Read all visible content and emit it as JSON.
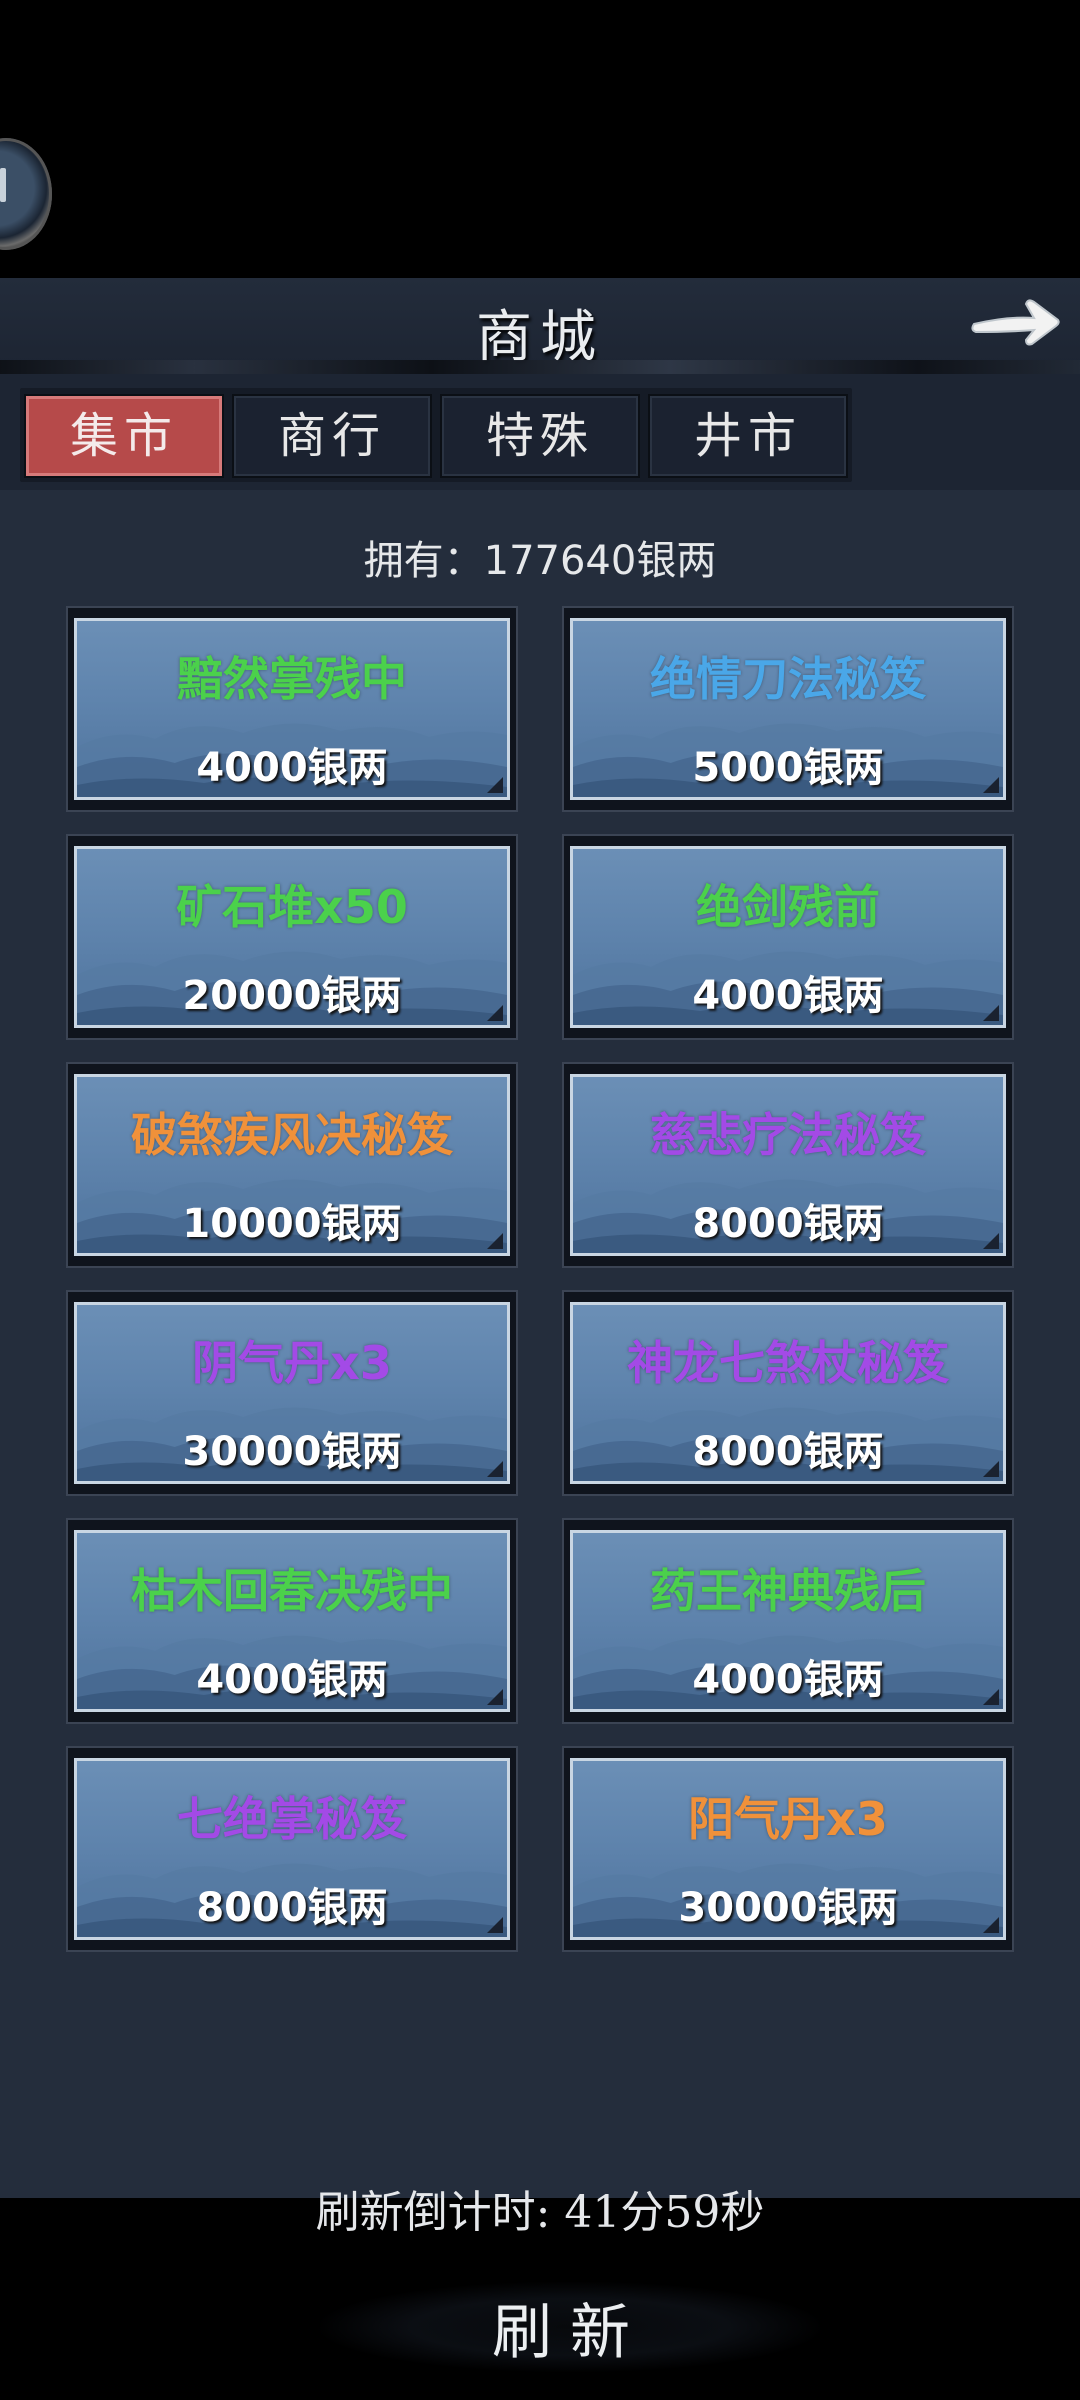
{
  "header": {
    "title": "商城"
  },
  "tabs": [
    {
      "label": "集市",
      "active": true
    },
    {
      "label": "商行",
      "active": false
    },
    {
      "label": "特殊",
      "active": false
    },
    {
      "label": "井市",
      "active": false
    }
  ],
  "owned_text": "拥有：177640银两",
  "items": [
    {
      "name": "黯然掌残中",
      "price": "4000银两",
      "color": "green"
    },
    {
      "name": "绝情刀法秘笈",
      "price": "5000银两",
      "color": "blue"
    },
    {
      "name": "矿石堆x50",
      "price": "20000银两",
      "color": "green"
    },
    {
      "name": "绝剑残前",
      "price": "4000银两",
      "color": "green"
    },
    {
      "name": "破煞疾风决秘笈",
      "price": "10000银两",
      "color": "orange"
    },
    {
      "name": "慈悲疗法秘笈",
      "price": "8000银两",
      "color": "purple"
    },
    {
      "name": "阴气丹x3",
      "price": "30000银两",
      "color": "purple"
    },
    {
      "name": "神龙七煞杖秘笈",
      "price": "8000银两",
      "color": "purple"
    },
    {
      "name": "枯木回春决残中",
      "price": "4000银两",
      "color": "green"
    },
    {
      "name": "药王神典残后",
      "price": "4000银两",
      "color": "green"
    },
    {
      "name": "七绝掌秘笈",
      "price": "8000银两",
      "color": "purple"
    },
    {
      "name": "阳气丹x3",
      "price": "30000银两",
      "color": "orange"
    }
  ],
  "countdown_text": "刷新倒计时: 41分59秒",
  "refresh_label": "刷新",
  "icons": {
    "back": "right-arrow-icon",
    "avatar": "avatar-frame"
  },
  "colors": {
    "green": "#4bd14b",
    "blue": "#4aa7e8",
    "orange": "#f0913a",
    "purple": "#a34ae6",
    "active_tab": "#b64a4a"
  }
}
